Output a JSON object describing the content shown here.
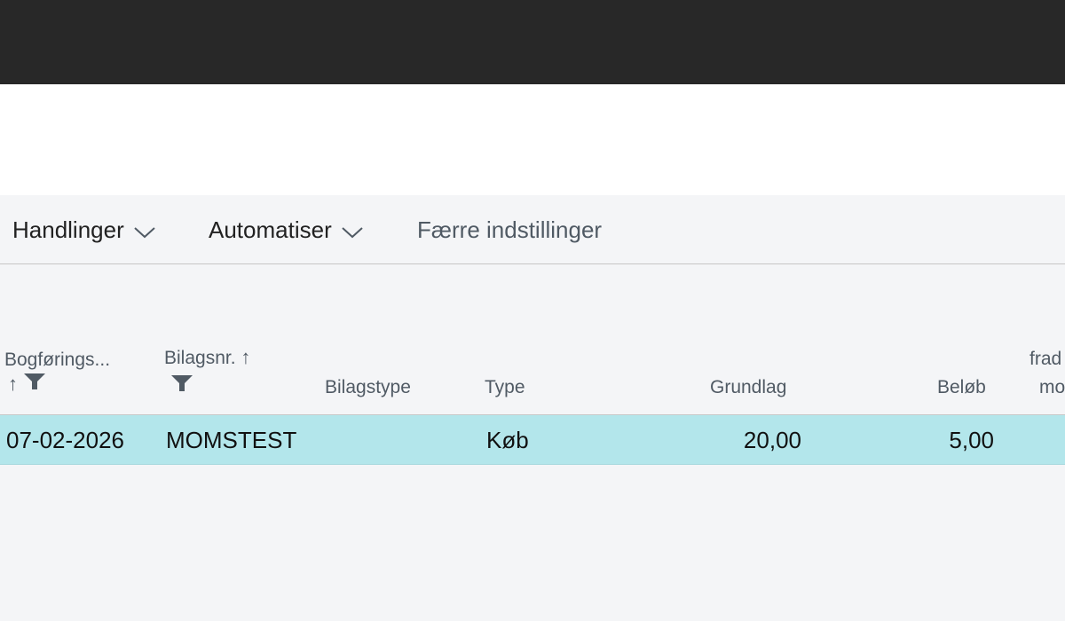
{
  "toolbar": {
    "actions_label": "Handlinger",
    "automate_label": "Automatiser",
    "fewer_options_label": "Færre indstillinger"
  },
  "grid": {
    "columns": {
      "posting_date": "Bogførings...",
      "document_no": "Bilagsnr.",
      "document_type": "Bilagstype",
      "type": "Type",
      "base": "Grundlag",
      "amount": "Beløb",
      "deductible_line1": "frad",
      "deductible_line2": "mo"
    },
    "sort_arrow": "↑",
    "rows": [
      {
        "posting_date": "07-02-2026",
        "document_no": "MOMSTEST",
        "document_type": "",
        "type": "Køb",
        "base": "20,00",
        "amount": "5,00"
      }
    ]
  },
  "colors": {
    "topbar": "#282828",
    "content_bg": "#f4f5f7",
    "selected_row": "#b3e6eb"
  }
}
